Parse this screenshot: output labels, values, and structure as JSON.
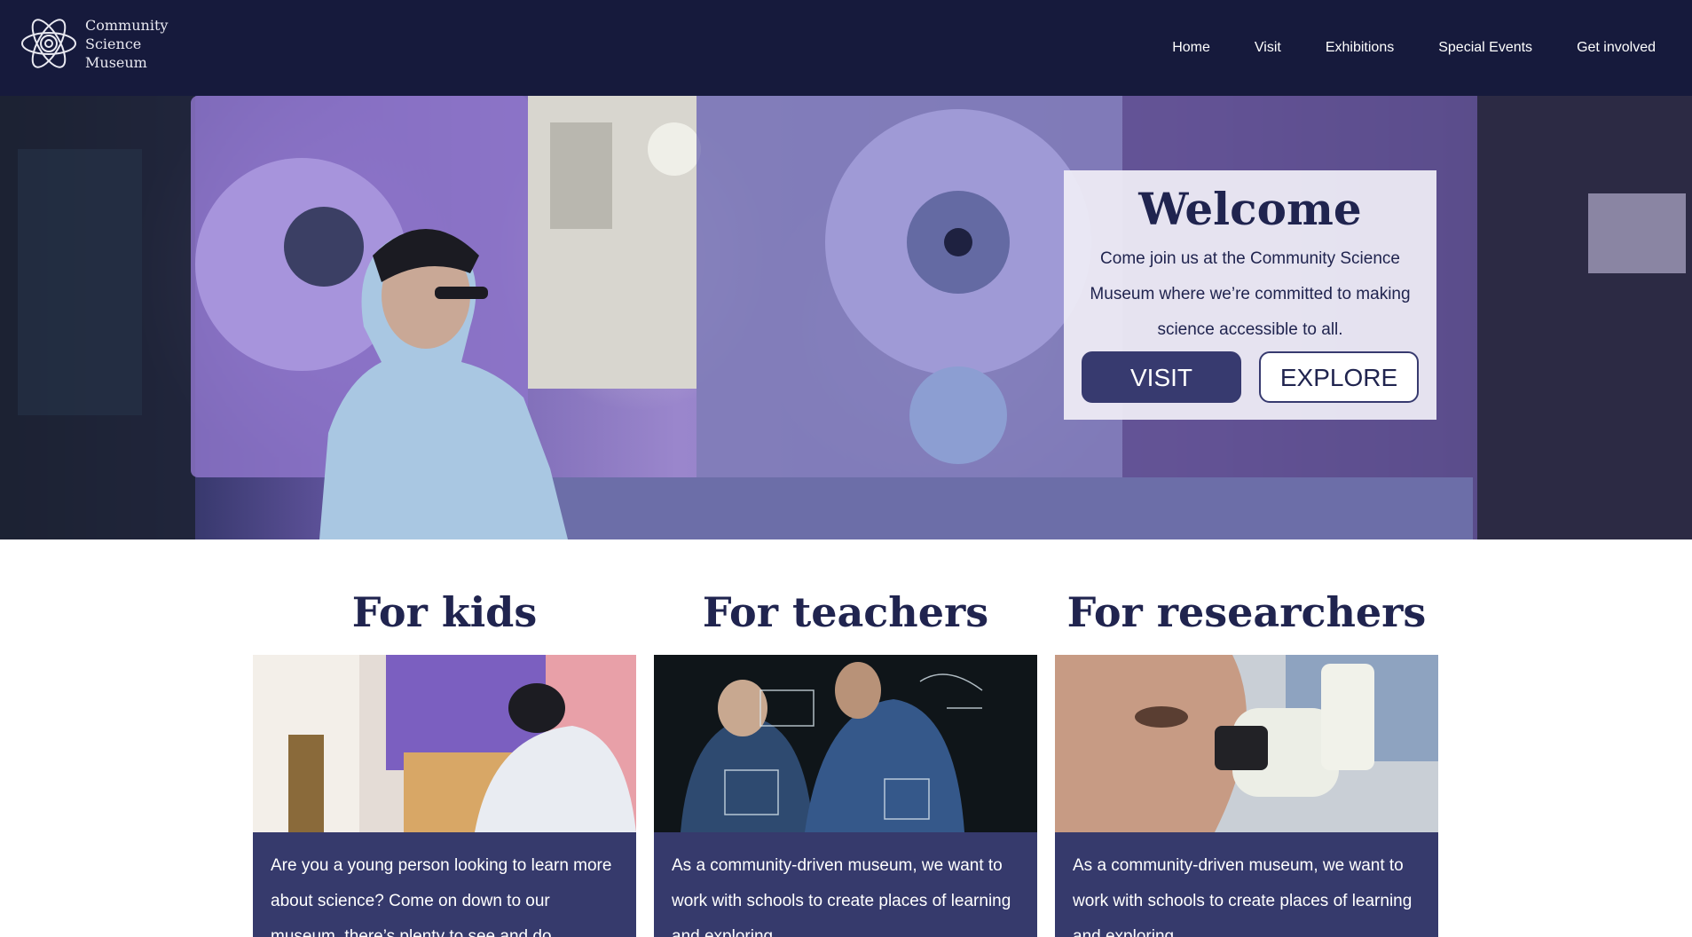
{
  "brand": {
    "logo_icon": "atom-icon",
    "name_line1": "Community",
    "name_line2": "Science",
    "name_line3": "Museum"
  },
  "nav": {
    "items": [
      {
        "label": "Home"
      },
      {
        "label": "Visit"
      },
      {
        "label": "Exhibitions"
      },
      {
        "label": "Special Events"
      },
      {
        "label": "Get involved"
      }
    ]
  },
  "hero": {
    "title": "Welcome",
    "text": "Come join us at the Community Science Museum where we’re committed to making science accessible to all.",
    "visit_label": "VISIT",
    "explore_label": "EXPLORE"
  },
  "audience": [
    {
      "heading": "For kids",
      "text": "Are you a young person looking to learn more about science? Come on down to our museum, there’s plenty to see and do."
    },
    {
      "heading": "For teachers",
      "text": "As a community-driven museum, we want to work with schools to create places of learning and exploring."
    },
    {
      "heading": "For researchers",
      "text": "As a community-driven museum, we want to work with schools to create places of learning and exploring."
    }
  ],
  "colors": {
    "header_bg": "#161a3c",
    "brand_navy": "#20244f",
    "button_fill": "#373a6f",
    "card_panel": "#363a6c"
  }
}
